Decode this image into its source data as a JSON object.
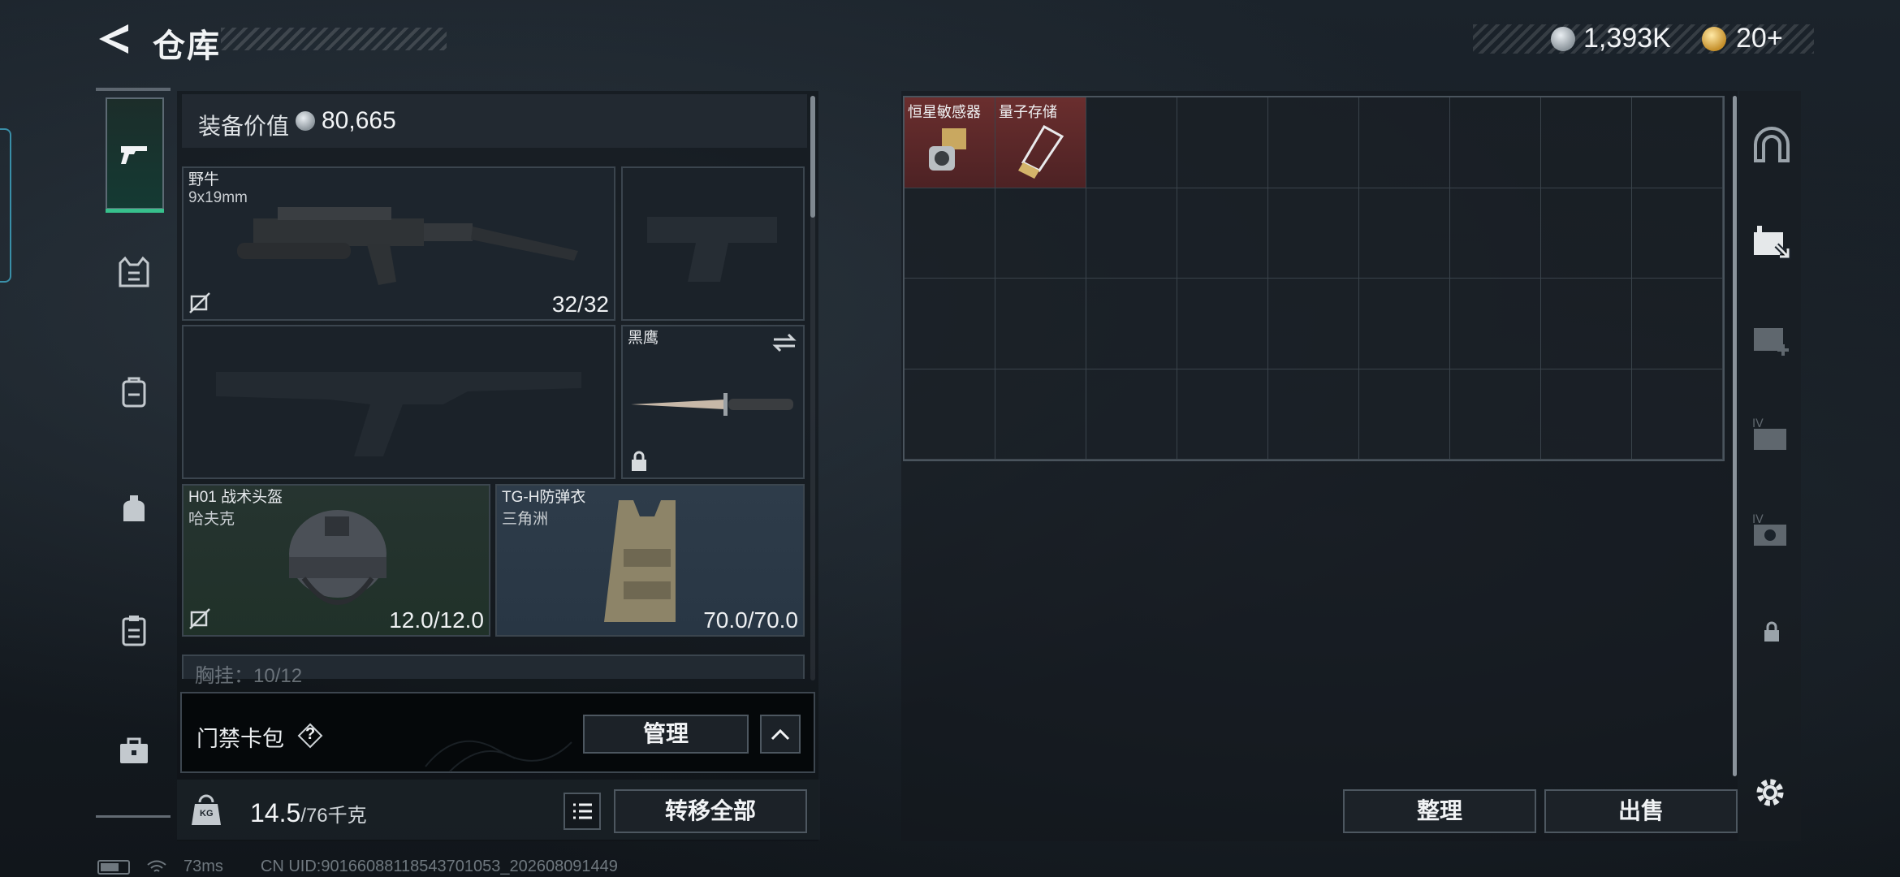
{
  "header": {
    "title": "仓库",
    "money": "1,393K",
    "gold": "20+"
  },
  "equipment": {
    "value_label": "装备价值",
    "value": "80,665",
    "primary": {
      "name": "野牛",
      "ammo_type": "9x19mm",
      "count": "32/32"
    },
    "melee": {
      "name": "黑鹰"
    },
    "helmet": {
      "name": "H01 战术头盔",
      "brand": "哈夫克",
      "durability": "12.0/12.0"
    },
    "armor": {
      "name": "TG-H防弹衣",
      "brand": "三角洲",
      "durability": "70.0/70.0"
    },
    "chest_label": "胸挂：10/12"
  },
  "keycard": {
    "label": "门禁卡包",
    "help_glyph": "?",
    "manage_label": "管理"
  },
  "footer": {
    "weight_current": "14.5",
    "weight_max": "/76千克",
    "weight_icon_text": "KG",
    "transfer_all_label": "转移全部"
  },
  "storage": {
    "items": [
      {
        "name": "恒星敏感器",
        "icon": "sensor-icon",
        "rarity_color": "#6a2e2e"
      },
      {
        "name": "量子存储",
        "icon": "usb-drive-icon",
        "rarity_color": "#6a2e2e"
      }
    ],
    "columns": 9,
    "rows": 4,
    "sort_label": "整理",
    "sell_label": "出售"
  },
  "status": {
    "ping": "73ms",
    "uid": "CN UID:90166088118543701053_202608091449"
  },
  "colors": {
    "accent_green": "#37c08c",
    "panel_bg": "#1a2129",
    "item_red": "#6a2e2e"
  }
}
